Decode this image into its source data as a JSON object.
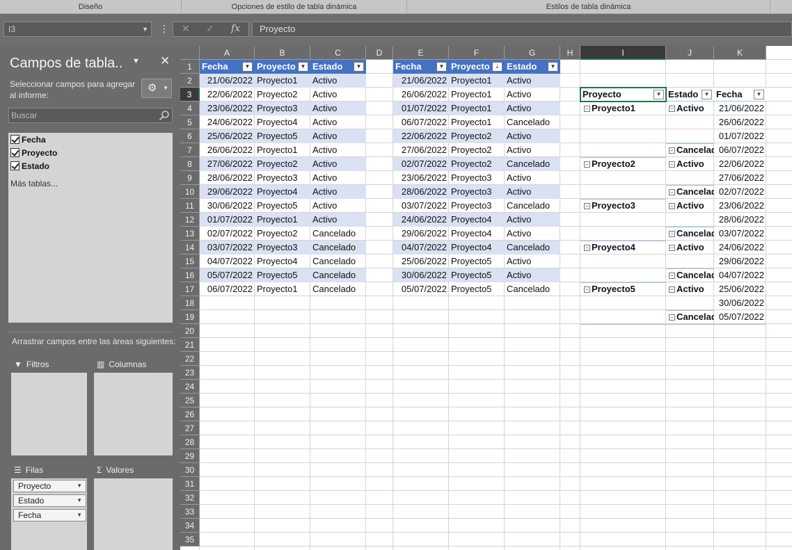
{
  "ribbon": {
    "groups": [
      "Diseño",
      "Opciones de estilo de tabla dinámica",
      "Estilos de tabla dinámica"
    ]
  },
  "formula_bar": {
    "name_box": "I3",
    "content": "Proyecto",
    "fx": "fx",
    "cancel": "✕",
    "enter": "✓"
  },
  "pane": {
    "title": "Campos de tabla..",
    "subtitle": "Seleccionar campos para agregar al informe:",
    "search_placeholder": "Buscar",
    "fields": [
      "Fecha",
      "Proyecto",
      "Estado"
    ],
    "more_tables": "Más tablas...",
    "drag_hint": "Arrastrar campos entre las áreas siguientes:",
    "areas": {
      "filters": "Filtros",
      "columns": "Columnas",
      "rows": "Filas",
      "values": "Valores"
    },
    "row_fields": [
      "Proyecto",
      "Estado",
      "Fecha"
    ]
  },
  "columns": [
    "A",
    "B",
    "C",
    "D",
    "E",
    "F",
    "G",
    "H",
    "I",
    "J",
    "K"
  ],
  "rows": [
    "1",
    "2",
    "3",
    "4",
    "5",
    "6",
    "7",
    "8",
    "9",
    "10",
    "11",
    "12",
    "13",
    "14",
    "15",
    "16",
    "17",
    "18",
    "19",
    "20",
    "21",
    "22",
    "23",
    "24",
    "25",
    "26",
    "27",
    "28",
    "29",
    "30",
    "31",
    "32",
    "33",
    "34",
    "35"
  ],
  "table1": {
    "headers": [
      "Fecha",
      "Proyecto",
      "Estado"
    ],
    "rows": [
      [
        "21/06/2022",
        "Proyecto1",
        "Activo"
      ],
      [
        "22/06/2022",
        "Proyecto2",
        "Activo"
      ],
      [
        "23/06/2022",
        "Proyecto3",
        "Activo"
      ],
      [
        "24/06/2022",
        "Proyecto4",
        "Activo"
      ],
      [
        "25/06/2022",
        "Proyecto5",
        "Activo"
      ],
      [
        "26/06/2022",
        "Proyecto1",
        "Activo"
      ],
      [
        "27/06/2022",
        "Proyecto2",
        "Activo"
      ],
      [
        "28/06/2022",
        "Proyecto3",
        "Activo"
      ],
      [
        "29/06/2022",
        "Proyecto4",
        "Activo"
      ],
      [
        "30/06/2022",
        "Proyecto5",
        "Activo"
      ],
      [
        "01/07/2022",
        "Proyecto1",
        "Activo"
      ],
      [
        "02/07/2022",
        "Proyecto2",
        "Cancelado"
      ],
      [
        "03/07/2022",
        "Proyecto3",
        "Cancelado"
      ],
      [
        "04/07/2022",
        "Proyecto4",
        "Cancelado"
      ],
      [
        "05/07/2022",
        "Proyecto5",
        "Cancelado"
      ],
      [
        "06/07/2022",
        "Proyecto1",
        "Cancelado"
      ]
    ]
  },
  "table2": {
    "headers": [
      "Fecha",
      "Proyecto",
      "Estado"
    ],
    "rows": [
      [
        "21/06/2022",
        "Proyecto1",
        "Activo"
      ],
      [
        "26/06/2022",
        "Proyecto1",
        "Activo"
      ],
      [
        "01/07/2022",
        "Proyecto1",
        "Activo"
      ],
      [
        "06/07/2022",
        "Proyecto1",
        "Cancelado"
      ],
      [
        "22/06/2022",
        "Proyecto2",
        "Activo"
      ],
      [
        "27/06/2022",
        "Proyecto2",
        "Activo"
      ],
      [
        "02/07/2022",
        "Proyecto2",
        "Cancelado"
      ],
      [
        "23/06/2022",
        "Proyecto3",
        "Activo"
      ],
      [
        "28/06/2022",
        "Proyecto3",
        "Activo"
      ],
      [
        "03/07/2022",
        "Proyecto3",
        "Cancelado"
      ],
      [
        "24/06/2022",
        "Proyecto4",
        "Activo"
      ],
      [
        "29/06/2022",
        "Proyecto4",
        "Activo"
      ],
      [
        "04/07/2022",
        "Proyecto4",
        "Cancelado"
      ],
      [
        "25/06/2022",
        "Proyecto5",
        "Activo"
      ],
      [
        "30/06/2022",
        "Proyecto5",
        "Activo"
      ],
      [
        "05/07/2022",
        "Proyecto5",
        "Cancelado"
      ]
    ]
  },
  "pivot": {
    "headers": [
      "Proyecto",
      "Estado",
      "Fecha"
    ],
    "rows": [
      [
        "Proyecto1",
        "Activo",
        "21/06/2022"
      ],
      [
        "",
        "",
        "26/06/2022"
      ],
      [
        "",
        "",
        "01/07/2022"
      ],
      [
        "",
        "Cancelado",
        "06/07/2022"
      ],
      [
        "Proyecto2",
        "Activo",
        "22/06/2022"
      ],
      [
        "",
        "",
        "27/06/2022"
      ],
      [
        "",
        "Cancelado",
        "02/07/2022"
      ],
      [
        "Proyecto3",
        "Activo",
        "23/06/2022"
      ],
      [
        "",
        "",
        "28/06/2022"
      ],
      [
        "",
        "Cancelado",
        "03/07/2022"
      ],
      [
        "Proyecto4",
        "Activo",
        "24/06/2022"
      ],
      [
        "",
        "",
        "29/06/2022"
      ],
      [
        "",
        "Cancelado",
        "04/07/2022"
      ],
      [
        "Proyecto5",
        "Activo",
        "25/06/2022"
      ],
      [
        "",
        "",
        "30/06/2022"
      ],
      [
        "",
        "Cancelado",
        "05/07/2022"
      ]
    ]
  }
}
